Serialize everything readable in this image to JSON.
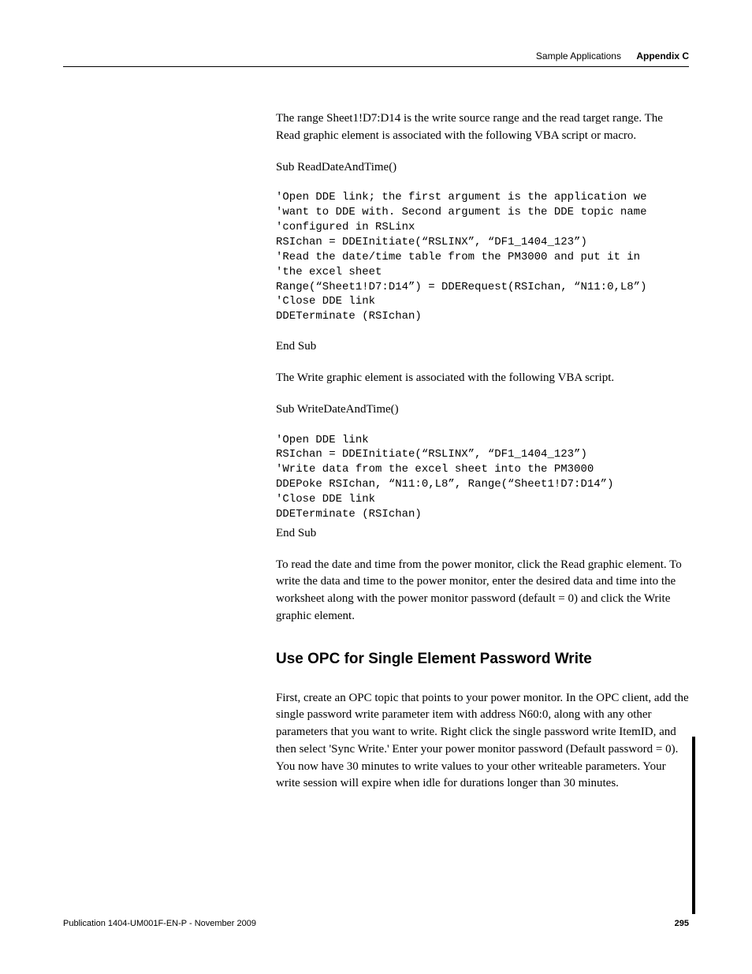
{
  "header": {
    "section": "Sample Applications",
    "appendix": "Appendix C"
  },
  "body": {
    "p1": "The range Sheet1!D7:D14 is the write source range and the read target range. The Read graphic element is associated with the following VBA script or macro.",
    "p2": "Sub ReadDateAndTime()",
    "code1": "'Open DDE link; the first argument is the application we\n'want to DDE with. Second argument is the DDE topic name\n'configured in RSLinx\nRSIchan = DDEInitiate(“RSLINX”, “DF1_1404_123”)\n'Read the date/time table from the PM3000 and put it in\n'the excel sheet\nRange(“Sheet1!D7:D14”) = DDERequest(RSIchan, “N11:0,L8”)\n'Close DDE link\nDDETerminate (RSIchan)",
    "p3": "End Sub",
    "p4": "The Write graphic element is associated with the following VBA script.",
    "p5": "Sub WriteDateAndTime()",
    "code2": "'Open DDE link\nRSIchan = DDEInitiate(“RSLINX”, “DF1_1404_123”)\n'Write data from the excel sheet into the PM3000\nDDEPoke RSIchan, “N11:0,L8”, Range(“Sheet1!D7:D14”)\n'Close DDE link\nDDETerminate (RSIchan)",
    "p6": "End Sub",
    "p7": "To read the date and time from the power monitor, click the Read graphic element. To write the data and time to the power monitor, enter the desired data and time into the worksheet along with the power monitor password (default = 0) and click the Write graphic element.",
    "h2": "Use OPC for Single Element Password Write",
    "p8": "First, create an OPC topic that points to your power monitor.  In the OPC client, add the single password write parameter item with address N60:0, along with any other parameters that you want to write. Right click the single password write ItemID, and then select 'Sync Write.' Enter your power monitor password (Default password = 0).  You now have 30 minutes to write values to your other writeable parameters.  Your write session will expire when idle for durations longer than 30 minutes."
  },
  "footer": {
    "publication": "Publication 1404-UM001F-EN-P - November 2009",
    "page": "295"
  }
}
